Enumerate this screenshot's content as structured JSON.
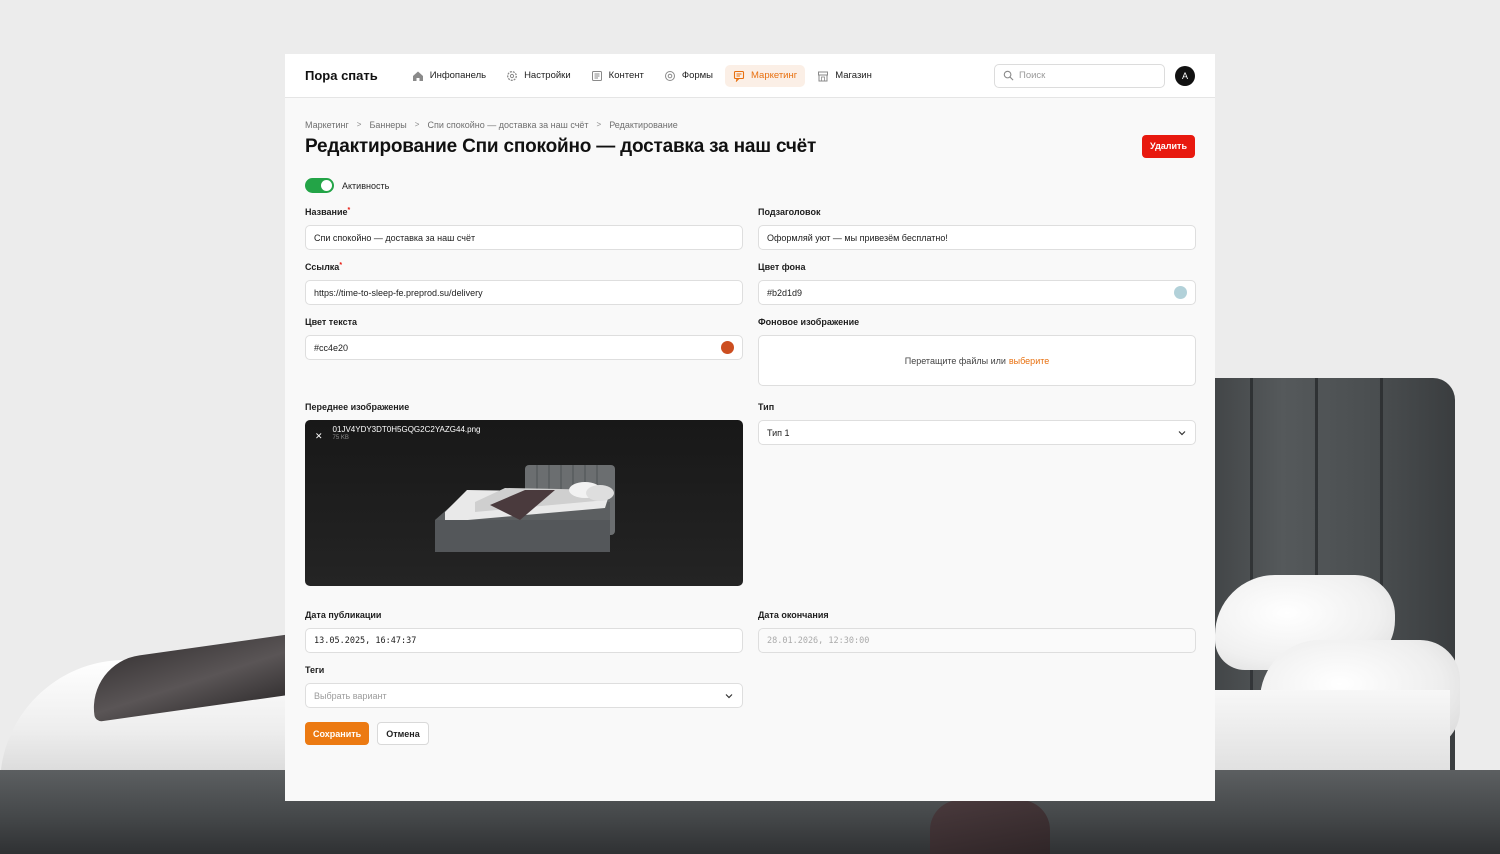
{
  "brand": "Пора спать",
  "nav": [
    {
      "label": "Инфопанель",
      "icon": "home-icon"
    },
    {
      "label": "Настройки",
      "icon": "gear-icon"
    },
    {
      "label": "Контент",
      "icon": "document-icon"
    },
    {
      "label": "Формы",
      "icon": "at-icon"
    },
    {
      "label": "Маркетинг",
      "icon": "marketing-icon",
      "active": true
    },
    {
      "label": "Магазин",
      "icon": "store-icon"
    }
  ],
  "search": {
    "placeholder": "Поиск"
  },
  "avatar": {
    "initial": "A"
  },
  "breadcrumb": [
    "Маркетинг",
    "Баннеры",
    "Спи спокойно — доставка за наш счёт",
    "Редактирование"
  ],
  "page_title": "Редактирование Спи спокойно — доставка за наш счёт",
  "delete_label": "Удалить",
  "activity": {
    "label": "Активность",
    "on": true
  },
  "fields": {
    "name": {
      "label": "Название",
      "value": "Спи спокойно — доставка за наш счёт"
    },
    "subtitle": {
      "label": "Подзаголовок",
      "value": "Оформляй уют — мы привезём бесплатно!"
    },
    "link": {
      "label": "Ссылка",
      "value": "https://time-to-sleep-fe.preprod.su/delivery"
    },
    "bg_color": {
      "label": "Цвет фона",
      "value": "#b2d1d9"
    },
    "text_color": {
      "label": "Цвет текста",
      "value": "#cc4e20"
    },
    "bg_image": {
      "label": "Фоновое изображение",
      "drop_text": "Перетащите файлы или",
      "drop_link": "выберите"
    },
    "front_image": {
      "label": "Переднее изображение",
      "file_name": "01JV4YDY3DT0H5GQG2C2YAZG44.png",
      "file_size": "75 KB"
    },
    "type": {
      "label": "Тип",
      "value": "Тип 1"
    },
    "publish_date": {
      "label": "Дата публикации",
      "value": "13.05.2025, 16:47:37"
    },
    "end_date": {
      "label": "Дата окончания",
      "value": "28.01.2026, 12:30:00"
    },
    "tags": {
      "label": "Теги",
      "placeholder": "Выбрать вариант"
    }
  },
  "save_label": "Сохранить",
  "cancel_label": "Отмена",
  "colors": {
    "accent": "#e8700f",
    "danger": "#e8190f",
    "toggle": "#23a447",
    "bg_swatch": "#b2d1d9",
    "text_swatch": "#cc4e20"
  }
}
